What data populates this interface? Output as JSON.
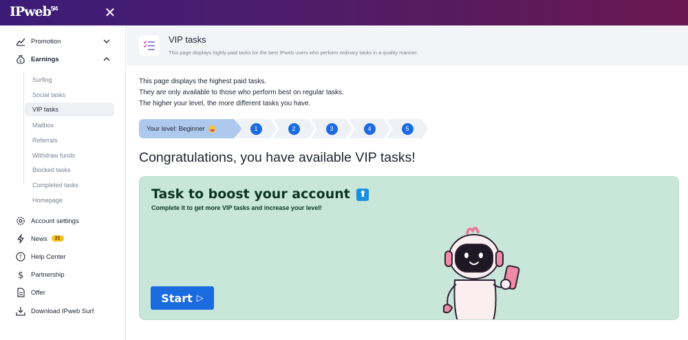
{
  "topbar": {
    "logo_text": "IPweb",
    "logo_sup": "5/4",
    "close_icon": "close-icon"
  },
  "sidebar": {
    "items": [
      {
        "label": "Promotion",
        "icon": "chart-icon"
      },
      {
        "label": "Earnings",
        "icon": "moneybag-icon"
      },
      {
        "label": "Account settings",
        "icon": "gear-icon"
      },
      {
        "label": "News",
        "icon": "lightning-icon",
        "badge": "21"
      },
      {
        "label": "Help Center",
        "icon": "question-icon"
      },
      {
        "label": "Partnership",
        "icon": "dollar-icon"
      },
      {
        "label": "Offer",
        "icon": "document-icon"
      },
      {
        "label": "Download IPweb Surf",
        "icon": "download-icon"
      }
    ],
    "subitems": [
      {
        "label": "Surfing"
      },
      {
        "label": "Social tasks"
      },
      {
        "label": "VIP tasks",
        "active": true
      },
      {
        "label": "Mailbox"
      },
      {
        "label": "Referrals"
      },
      {
        "label": "Withdraw funds"
      },
      {
        "label": "Blocked tasks"
      },
      {
        "label": "Completed tasks"
      },
      {
        "label": "Homepage"
      }
    ]
  },
  "header": {
    "title": "VIP tasks",
    "subtitle": "This page displays highly paid tasks for the best IPweb users who perform ordinary tasks in a quality manner."
  },
  "intro": {
    "line1": "This page displays the highest paid tasks.",
    "line2": "They are only available to those who perform best on regular tasks.",
    "line3": "The higher your level, the more different tasks you have."
  },
  "progress": {
    "level_label": "Your level: Beginner",
    "steps": [
      "1",
      "2",
      "3",
      "4",
      "5"
    ]
  },
  "congrats": "Congratulations, you have available VIP tasks!",
  "card": {
    "title": "Task to boost your account",
    "subtitle": "Complete it to get more VIP tasks and increase your level!",
    "button": "Start"
  },
  "colors": {
    "accent": "#1a6ae0",
    "card_bg": "#c8e6d9",
    "level_bg": "#aec8ee",
    "badge": "#f7c31b"
  }
}
